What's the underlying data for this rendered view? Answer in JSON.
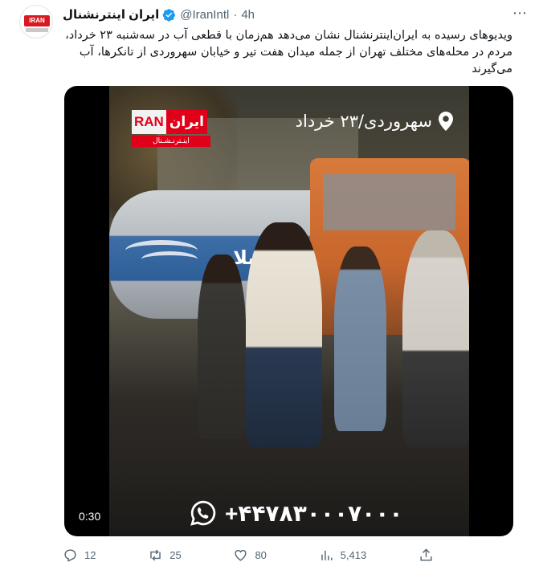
{
  "account": {
    "display_name": "ایران اینترنشنال",
    "handle": "@IranIntl",
    "separator": "·",
    "time": "4h",
    "more": "⋯",
    "avatar_text": "IRAN"
  },
  "tweet": {
    "text": "ویدیوهای رسیده به ایران‌اینترنشنال نشان می‌دهد هم‌زمان با قطعی آب در سه‌شنبه ۲۳ خرداد، مردم در محله‌های مختلف تهران از جمله میدان هفت تیر و خیابان سهروردی از تانکرها، آب می‌گیرند"
  },
  "media": {
    "duration": "0:30",
    "watermark_logo_red": "ایران",
    "watermark_logo_white": "RAN",
    "watermark_logo_sub": "اینـترنـشـنال",
    "location_overlay": "سهروردی/۲۳ خرداد",
    "phone_overlay": "+۴۴۷۸۳۰۰۰۷۰۰۰",
    "tanker_label": "فاضلاب"
  },
  "actions": {
    "reply_count": "12",
    "retweet_count": "25",
    "like_count": "80",
    "views_count": "5,413"
  },
  "icons": {
    "verified": "verified-badge-icon",
    "reply": "reply-icon",
    "retweet": "retweet-icon",
    "like": "heart-icon",
    "views": "views-chart-icon",
    "share": "share-icon",
    "location": "location-pin-icon",
    "whatsapp": "whatsapp-icon"
  },
  "colors": {
    "verified": "#1d9bf0",
    "brand_red": "#e1001a",
    "muted": "#536471"
  }
}
